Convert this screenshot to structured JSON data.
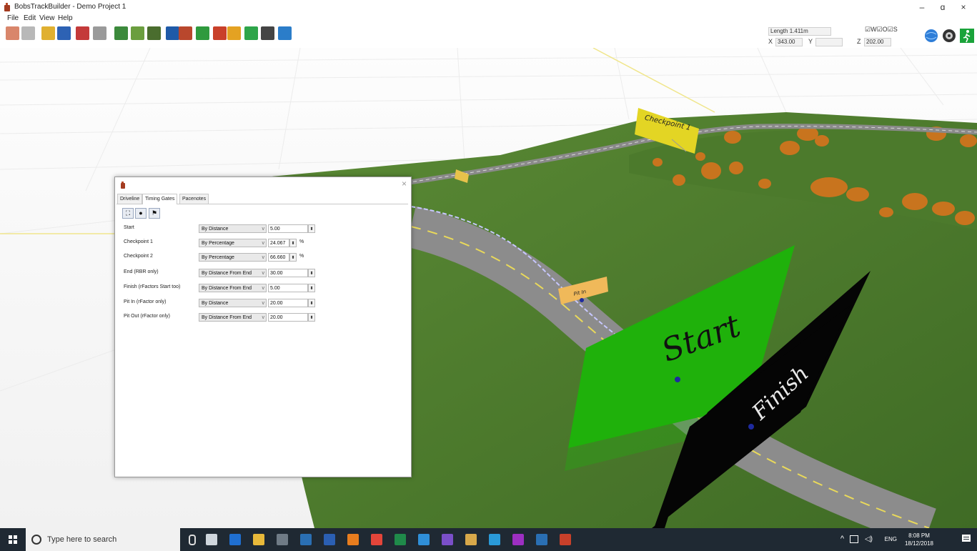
{
  "app": {
    "title": "BobsTrackBuilder - Demo Project 1",
    "window_controls": {
      "minimize": "–",
      "maximize": "ɑ",
      "close": "×"
    }
  },
  "menu": [
    "File",
    "Edit",
    "View",
    "Help"
  ],
  "toolbar": {
    "icons": [
      "track-icon",
      "road-edit-icon",
      "terrain-icon",
      "camera-view-icon",
      "wall-icon",
      "text-icon",
      "spline-icon",
      "texture-icon",
      "grass-icon",
      "paint-icon",
      "brick-icon",
      "mountain-icon",
      "objects-icon",
      "brush-icon",
      "grid-texture-icon",
      "spectators-icon",
      "water-icon"
    ],
    "readout": {
      "length_label": "Length 1.411m",
      "x_label": "X",
      "x_value": "343.00",
      "y_label": "Y",
      "y_value": "",
      "z_label": "Z",
      "z_value": "202.00"
    },
    "flags": "☑W☑O☑S",
    "right_icons": [
      "globe-icon",
      "steering-wheel-icon",
      "run-icon"
    ]
  },
  "scene": {
    "signs": {
      "checkpoint1": "Checkpoint 1",
      "pit_in": "Pit In",
      "start": "Start",
      "finish": "Finish"
    }
  },
  "dialog": {
    "close": "×",
    "tabs": [
      "Driveline",
      "Timing Gates",
      "Pacenotes"
    ],
    "active_tab": "Timing Gates",
    "gates": [
      {
        "label": "Start",
        "mode": "By Distance",
        "value": "5.00",
        "unit": ""
      },
      {
        "label": "Checkpoint 1",
        "mode": "By Percentage",
        "value": "24.067",
        "unit": "%"
      },
      {
        "label": "Checkpoint 2",
        "mode": "By Percentage",
        "value": "66.660",
        "unit": "%"
      },
      {
        "label": "End (RBR only)",
        "mode": "By Distance From End",
        "value": "30.00",
        "unit": ""
      },
      {
        "label": "Finish (rFactors Start too)",
        "mode": "By Distance From End",
        "value": "5.00",
        "unit": ""
      },
      {
        "label": "Pit In (rFactor only)",
        "mode": "By Distance",
        "value": "20.00",
        "unit": ""
      },
      {
        "label": "Pit Out (rFactor only)",
        "mode": "By Distance From End",
        "value": "20.00",
        "unit": ""
      }
    ]
  },
  "taskbar": {
    "search_placeholder": "Type here to search",
    "apps": [
      "task-view-icon",
      "outlook-icon",
      "file-explorer-icon",
      "gaming-icon",
      "steam-icon",
      "word-icon",
      "blender-icon",
      "chrome-icon",
      "excel-icon",
      "vscode-icon",
      "visual-studio-icon",
      "paint-icon",
      "media-encoder-icon",
      "premiere-icon",
      "steam2-icon",
      "bobstrackbuilder-icon"
    ],
    "tray": {
      "lang": "ENG",
      "time": "8:08 PM",
      "date": "18/12/2018",
      "chevron": "^"
    }
  },
  "colors": {
    "grass": "#4f7f2d",
    "road": "#8a8a8a",
    "start_panel": "#1fb10b",
    "finish_panel": "#050505",
    "checkpoint_sign": "#e3d524",
    "pit_sign": "#f0b95a",
    "taskbar": "#1f2933",
    "autumn_trees": "#c8741e"
  }
}
